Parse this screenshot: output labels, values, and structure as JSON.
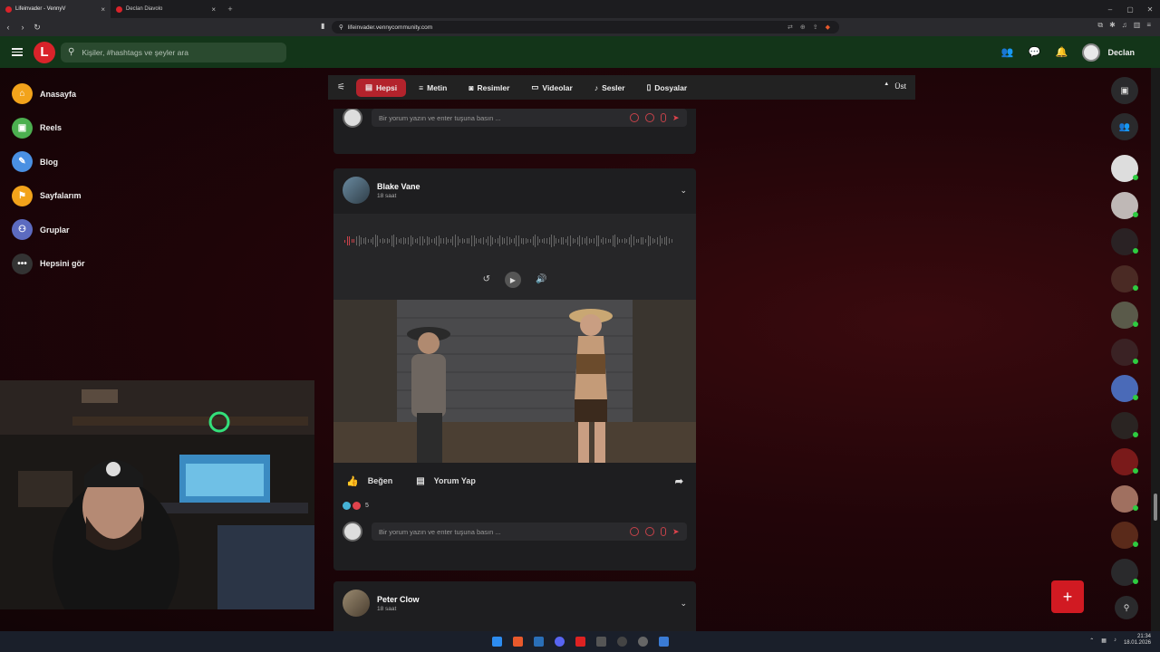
{
  "browser": {
    "tabs": [
      {
        "label": "Lifeinvader - VennyV",
        "active": true
      },
      {
        "label": "Declan Diavolo",
        "active": false
      }
    ],
    "url": "lifeinvader.vennycommunity.com"
  },
  "header": {
    "search_placeholder": "Kişiler, #hashtags ve şeyler ara",
    "user_name": "Declan",
    "accent": "#d9232a",
    "bg": "#133519"
  },
  "sidebar": {
    "items": [
      {
        "label": "Anasayfa",
        "icon": "home-icon",
        "color": "#f2a31b"
      },
      {
        "label": "Reels",
        "icon": "reels-icon",
        "color": "#4caf50"
      },
      {
        "label": "Blog",
        "icon": "blog-icon",
        "color": "#4a90e2"
      },
      {
        "label": "Sayfalarım",
        "icon": "flag-icon",
        "color": "#f2a31b"
      },
      {
        "label": "Gruplar",
        "icon": "group-icon",
        "color": "#5c6bc0"
      },
      {
        "label": "Hepsini gör",
        "icon": "more-icon",
        "color": "#333"
      }
    ]
  },
  "filters": {
    "items": [
      {
        "label": "Hepsi",
        "icon": "all-icon",
        "active": true
      },
      {
        "label": "Metin",
        "icon": "text-icon",
        "active": false
      },
      {
        "label": "Resimler",
        "icon": "camera-icon",
        "active": false
      },
      {
        "label": "Videolar",
        "icon": "video-icon",
        "active": false
      },
      {
        "label": "Sesler",
        "icon": "music-icon",
        "active": false
      },
      {
        "label": "Dosyalar",
        "icon": "file-icon",
        "active": false
      }
    ],
    "top_label": "Üst"
  },
  "comment_placeholder": "Bir yorum yazın ve enter tuşuna basın ...",
  "posts": [
    {
      "author": "Blake Vane",
      "time": "18 saat",
      "like_label": "Beğen",
      "comment_label": "Yorum Yap",
      "reaction_count": "5"
    },
    {
      "author": "Peter Clow",
      "time": "18 saat"
    }
  ],
  "taskbar": {
    "time": "21:34",
    "date": "18.01.2026"
  }
}
